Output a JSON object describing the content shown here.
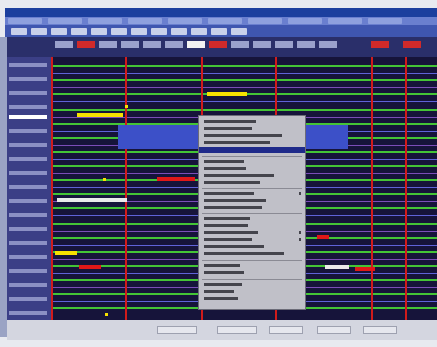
{
  "window": {
    "title": ""
  },
  "menubar": {
    "items": [
      "",
      "",
      "",
      "",
      "",
      "",
      "",
      "",
      "",
      ""
    ]
  },
  "toolbar": {
    "buttons": 12
  },
  "context_menu": {
    "items": []
  },
  "statusbar": {
    "fields": [
      "",
      "",
      "",
      "",
      ""
    ]
  },
  "colors": {
    "accent": "#1c3f9e",
    "grid_background": "#16143a",
    "timeline_green": "#44c436",
    "divider_red": "#d11b1b",
    "highlight_yellow": "#f6e100",
    "menu_background": "#c0c0c8",
    "menu_highlight": "#1f2a8a"
  }
}
